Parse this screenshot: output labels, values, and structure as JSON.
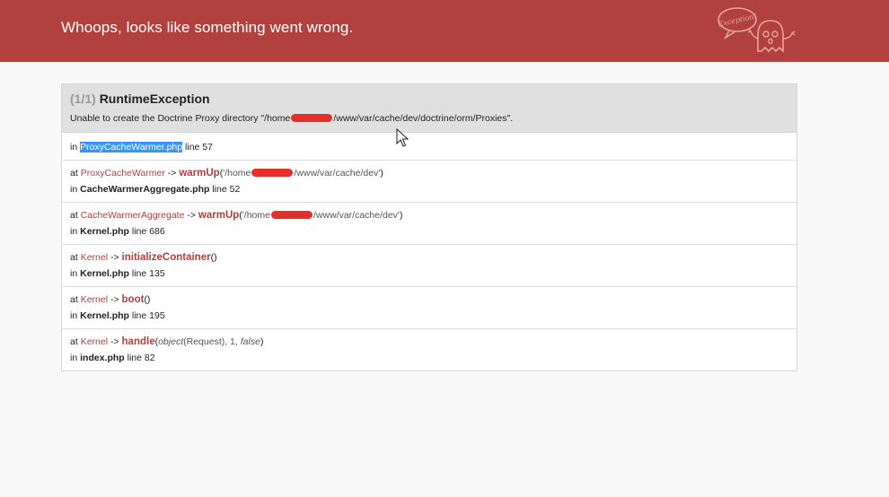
{
  "header": {
    "title": "Whoops, looks like something went wrong.",
    "mascot_text": "Exception!"
  },
  "exception": {
    "count": "(1/1)",
    "name": "RuntimeException",
    "message_prefix": "Unable to create the Doctrine Proxy directory \"/home",
    "message_suffix": "/www/var/cache/dev/doctrine/orm/Proxies\"."
  },
  "frames": [
    {
      "in_prefix": "in",
      "file": "ProxyCacheWarmer.php",
      "line_text": "line 57"
    },
    {
      "at": "at",
      "class": "ProxyCacheWarmer",
      "arrow": "->",
      "method": "warmUp",
      "open": "(",
      "arg_prefix": "'/home",
      "arg_suffix": "/www/var/cache/dev'",
      "close": ")",
      "in_prefix": "in",
      "file": "CacheWarmerAggregate.php",
      "line_text": "line 52"
    },
    {
      "at": "at",
      "class": "CacheWarmerAggregate",
      "arrow": "->",
      "method": "warmUp",
      "open": "(",
      "arg_prefix": "'/home",
      "arg_suffix": "/www/var/cache/dev'",
      "close": ")",
      "in_prefix": "in",
      "file": "Kernel.php",
      "line_text": "line 686"
    },
    {
      "at": "at",
      "class": "Kernel",
      "arrow": "->",
      "method": "initializeContainer",
      "args": "()",
      "in_prefix": "in",
      "file": "Kernel.php",
      "line_text": "line 135"
    },
    {
      "at": "at",
      "class": "Kernel",
      "arrow": "->",
      "method": "boot",
      "args": "()",
      "in_prefix": "in",
      "file": "Kernel.php",
      "line_text": "line 195"
    },
    {
      "at": "at",
      "class": "Kernel",
      "arrow": "->",
      "method": "handle",
      "open": "(",
      "arg_obj": "object",
      "arg_mid": "(Request), 1, ",
      "arg_false": "false",
      "close": ")",
      "in_prefix": "in",
      "file": "index.php",
      "line_text": "line 82"
    }
  ],
  "colors": {
    "header_bg": "#b0413e",
    "accent": "#b0413e",
    "highlight": "#3297fd",
    "redaction": "#e3302a"
  }
}
